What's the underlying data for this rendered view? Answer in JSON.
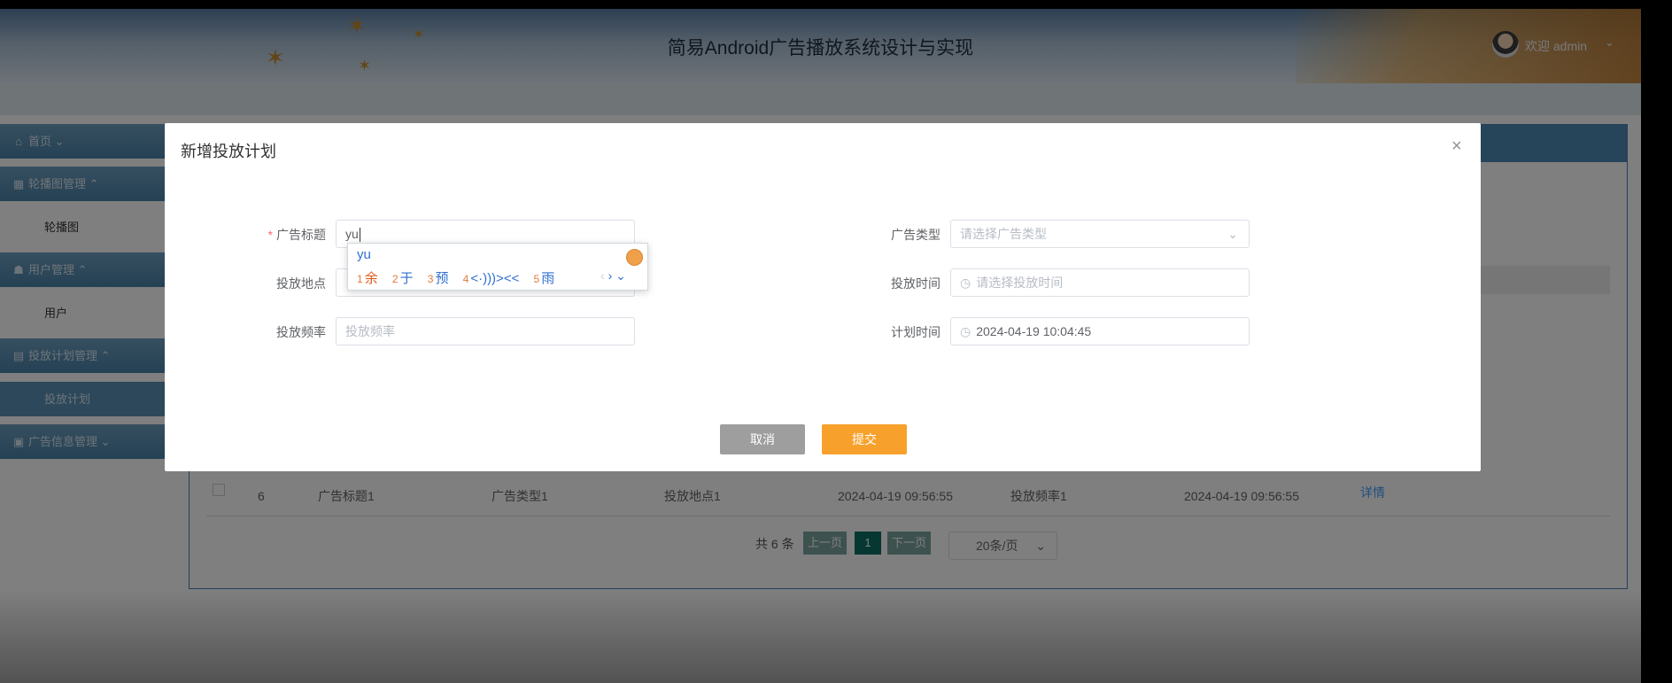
{
  "app": {
    "title": "简易Android广告播放系统设计与实现",
    "welcome": "欢迎 admin",
    "caret": "⌄"
  },
  "sidebar": {
    "items": [
      {
        "icon": "⌂",
        "label": "首页 ⌄"
      },
      {
        "icon": "▦",
        "label": "轮播图管理 ⌃"
      },
      {
        "sub": "轮播图"
      },
      {
        "icon": "☗",
        "label": "用户管理 ⌃"
      },
      {
        "sub": "用户"
      },
      {
        "icon": "▤",
        "label": "投放计划管理 ⌃"
      },
      {
        "sub": "投放计划"
      },
      {
        "icon": "▣",
        "label": "广告信息管理 ⌄"
      }
    ]
  },
  "table": {
    "row": {
      "index": "6",
      "title": "广告标题1",
      "type": "广告类型1",
      "location": "投放地点1",
      "created": "2024-04-19 09:56:55",
      "frequency": "投放频率1",
      "plan_time": "2024-04-19 09:56:55",
      "action": "详情"
    }
  },
  "pagination": {
    "total": "共 6 条",
    "prev": "上一页",
    "page": "1",
    "next": "下一页",
    "size": "20条/页",
    "size_chevron": "⌄"
  },
  "dialog": {
    "title": "新增投放计划",
    "close": "×",
    "fields": {
      "ad_title": {
        "required": "*",
        "label": "广告标题",
        "value": "yu"
      },
      "ad_type": {
        "label": "广告类型",
        "placeholder": "请选择广告类型",
        "chevron": "⌄"
      },
      "location": {
        "label": "投放地点"
      },
      "delivery_time": {
        "label": "投放时间",
        "icon": "◷",
        "placeholder": "请选择投放时间"
      },
      "frequency": {
        "label": "投放频率",
        "placeholder": "投放频率"
      },
      "plan_time": {
        "label": "计划时间",
        "icon": "◷",
        "value": "2024-04-19 10:04:45"
      }
    },
    "cancel": "取消",
    "submit": "提交"
  },
  "ime": {
    "composition": "yu",
    "candidates": [
      {
        "n": "1",
        "text": "余"
      },
      {
        "n": "2",
        "text": "于"
      },
      {
        "n": "3",
        "text": "预"
      },
      {
        "n": "4",
        "text": "<·)))><<"
      },
      {
        "n": "5",
        "text": "雨"
      }
    ],
    "nav_prev": "‹",
    "nav_next": "›",
    "nav_more": "⌄"
  }
}
